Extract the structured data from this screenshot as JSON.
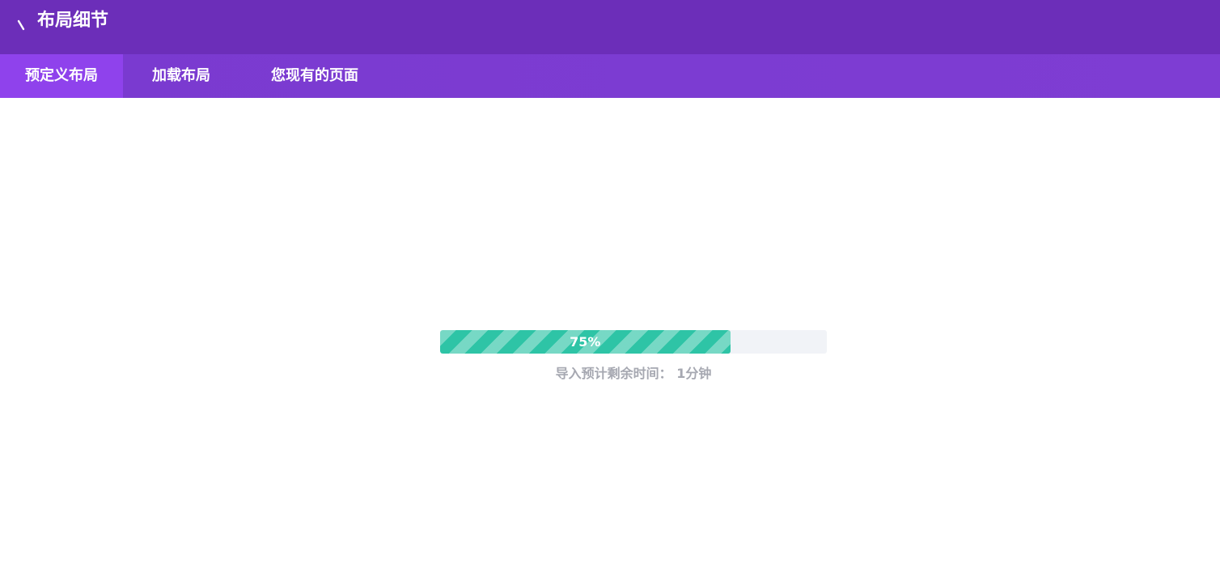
{
  "header": {
    "title": "布局细节",
    "back_icon": "back-arrow-icon",
    "background_color": "#6c2eb9"
  },
  "tabs": [
    {
      "label": "预定义布局",
      "active": true
    },
    {
      "label": "加载布局",
      "active": false
    },
    {
      "label": "您现有的页面",
      "active": false
    }
  ],
  "progress": {
    "percent": 75,
    "label": "75%",
    "fill_color": "#2ec4a6",
    "track_color": "#f1f3f7"
  },
  "eta": {
    "text": "导入预计剩余时间： 1分钟"
  }
}
